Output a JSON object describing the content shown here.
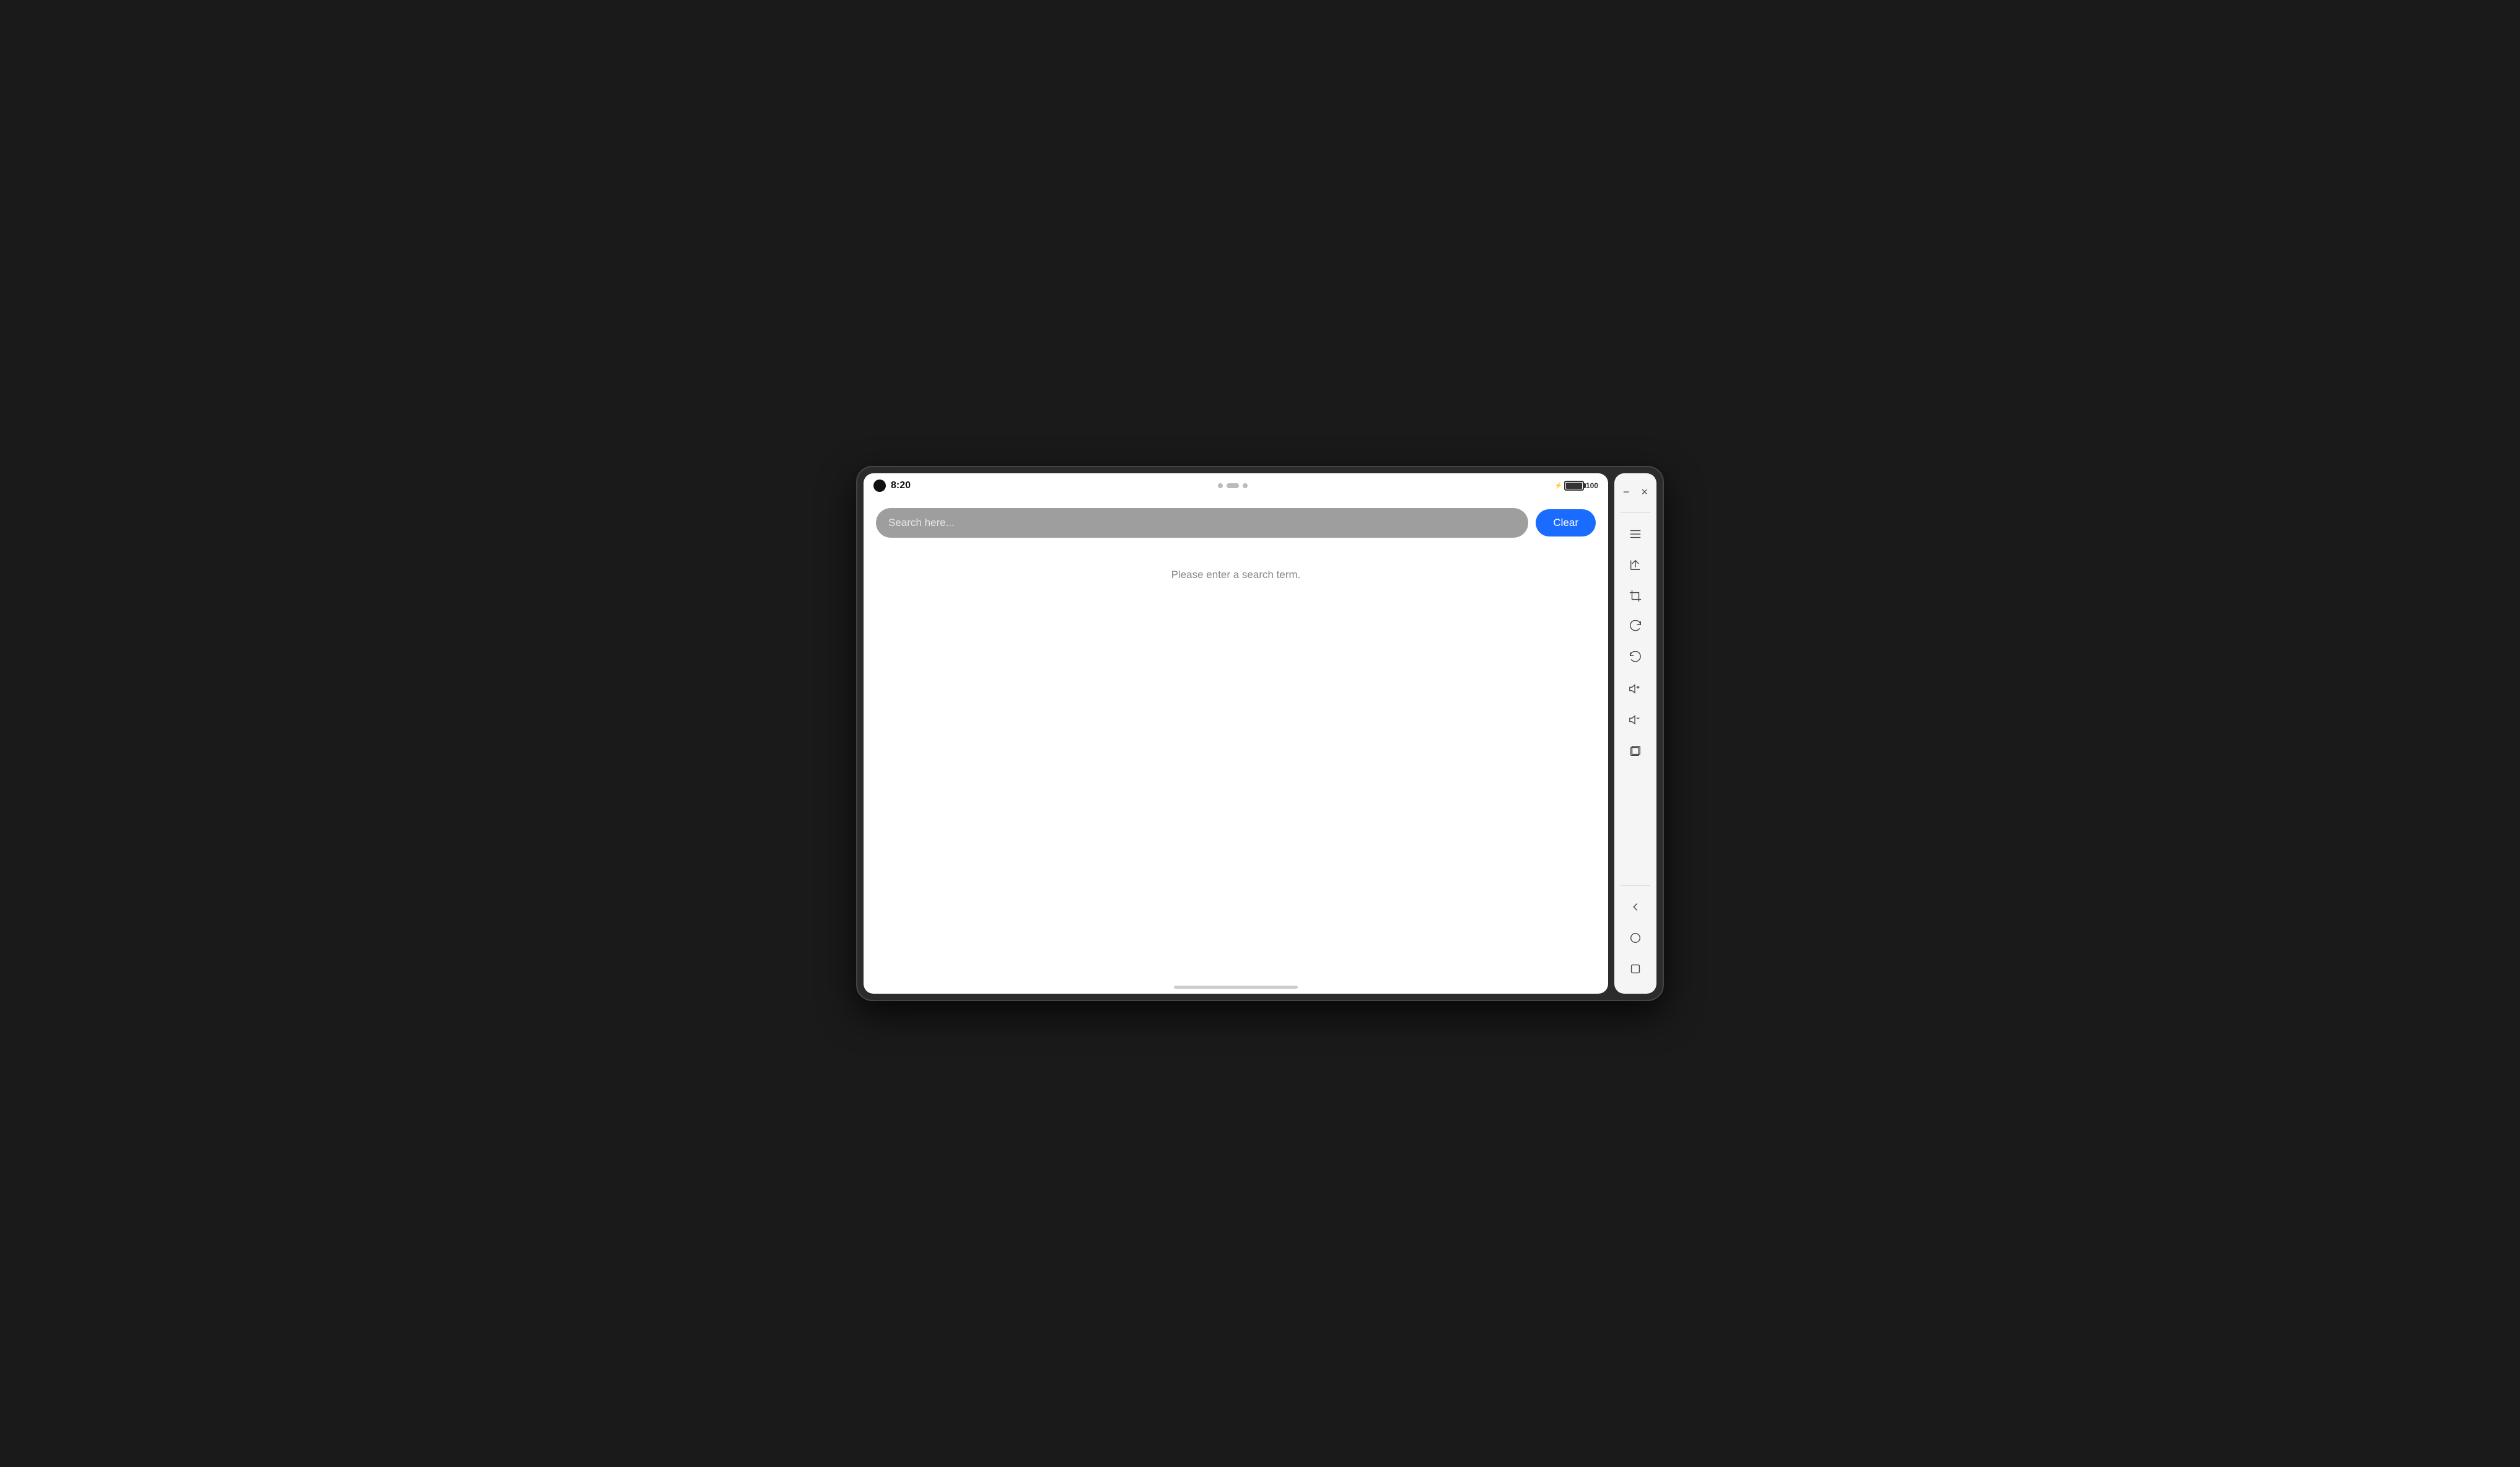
{
  "status_bar": {
    "time": "8:20",
    "battery_percent": "100"
  },
  "search": {
    "placeholder": "Search here...",
    "value": "",
    "empty_message": "Please enter a search term."
  },
  "buttons": {
    "clear_label": "Clear"
  },
  "window": {
    "minimize_label": "−",
    "close_label": "×"
  },
  "icons": {
    "hamburger": "☰",
    "upload": "↑",
    "crop": "⌞",
    "rotate_cw": "↻",
    "rotate_ccw": "↺",
    "volume_up": "◁+",
    "volume_down": "◁−",
    "layers": "❑",
    "back": "◁",
    "home": "○",
    "square": "□"
  }
}
